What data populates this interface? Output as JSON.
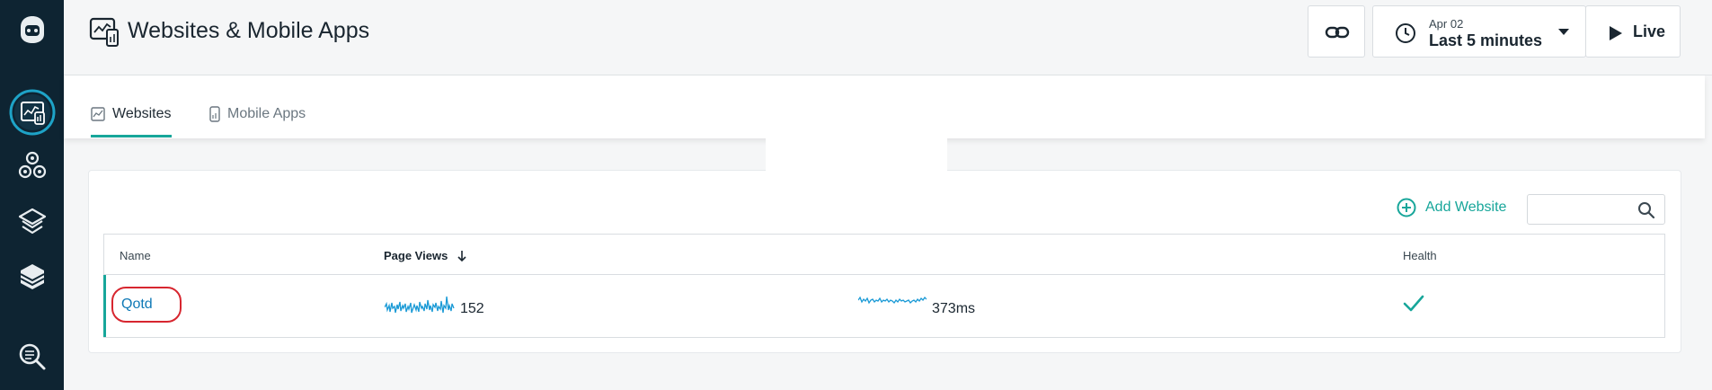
{
  "header": {
    "title": "Websites & Mobile Apps",
    "time_date": "Apr 02",
    "time_range": "Last 5 minutes",
    "live_label": "Live"
  },
  "tabs": [
    {
      "label": "Websites",
      "icon": "chart-icon",
      "active": true
    },
    {
      "label": "Mobile Apps",
      "icon": "mobile-icon",
      "active": false
    }
  ],
  "toolbar": {
    "add_label": "Add Website",
    "search_value": "",
    "search_placeholder": ""
  },
  "table": {
    "columns": [
      "Name",
      "Page Views",
      "Health"
    ],
    "sort_column": "Page Views",
    "sort_direction": "descending",
    "rows": [
      {
        "name": "Qotd",
        "page_views": "152",
        "load_time": "373ms",
        "health": "healthy"
      }
    ]
  },
  "sidebar": {
    "items": [
      "logo-icon",
      "websites-icon",
      "infrastructure-icon",
      "platform-icon",
      "applications-icon",
      "analyze-icon"
    ],
    "active": "websites-icon"
  },
  "colors": {
    "accent": "#17a69a",
    "link": "#0f79b6",
    "sidebar_bg": "#0e2432",
    "highlight": "#d7262f",
    "sparkline": "#1a9ad6"
  }
}
